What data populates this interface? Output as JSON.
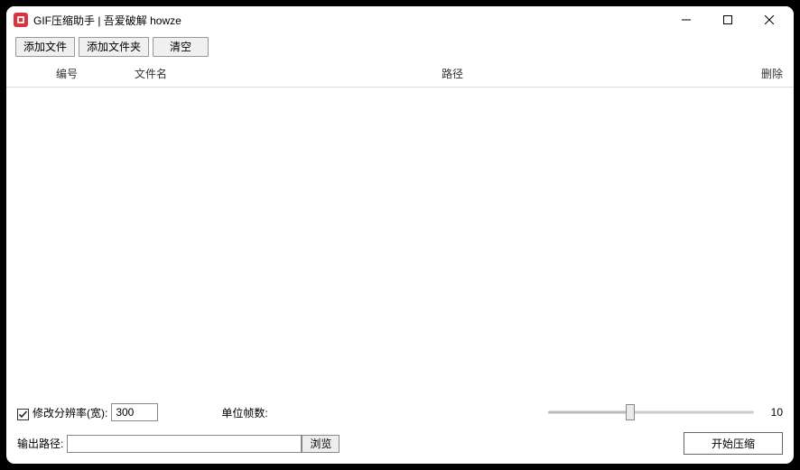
{
  "window": {
    "title": "GIF压缩助手 | 吾爱破解 howze"
  },
  "toolbar": {
    "add_file": "添加文件",
    "add_folder": "添加文件夹",
    "clear": "清空"
  },
  "columns": {
    "number": "编号",
    "filename": "文件名",
    "path": "路径",
    "delete": "删除"
  },
  "rows": [],
  "resize": {
    "checked": true,
    "label": "修改分辨率(宽):",
    "value": "300"
  },
  "frames": {
    "label": "单位帧数:",
    "slider_value": 10
  },
  "output": {
    "label": "输出路径:",
    "value": "",
    "browse": "浏览"
  },
  "actions": {
    "start": "开始压缩"
  }
}
